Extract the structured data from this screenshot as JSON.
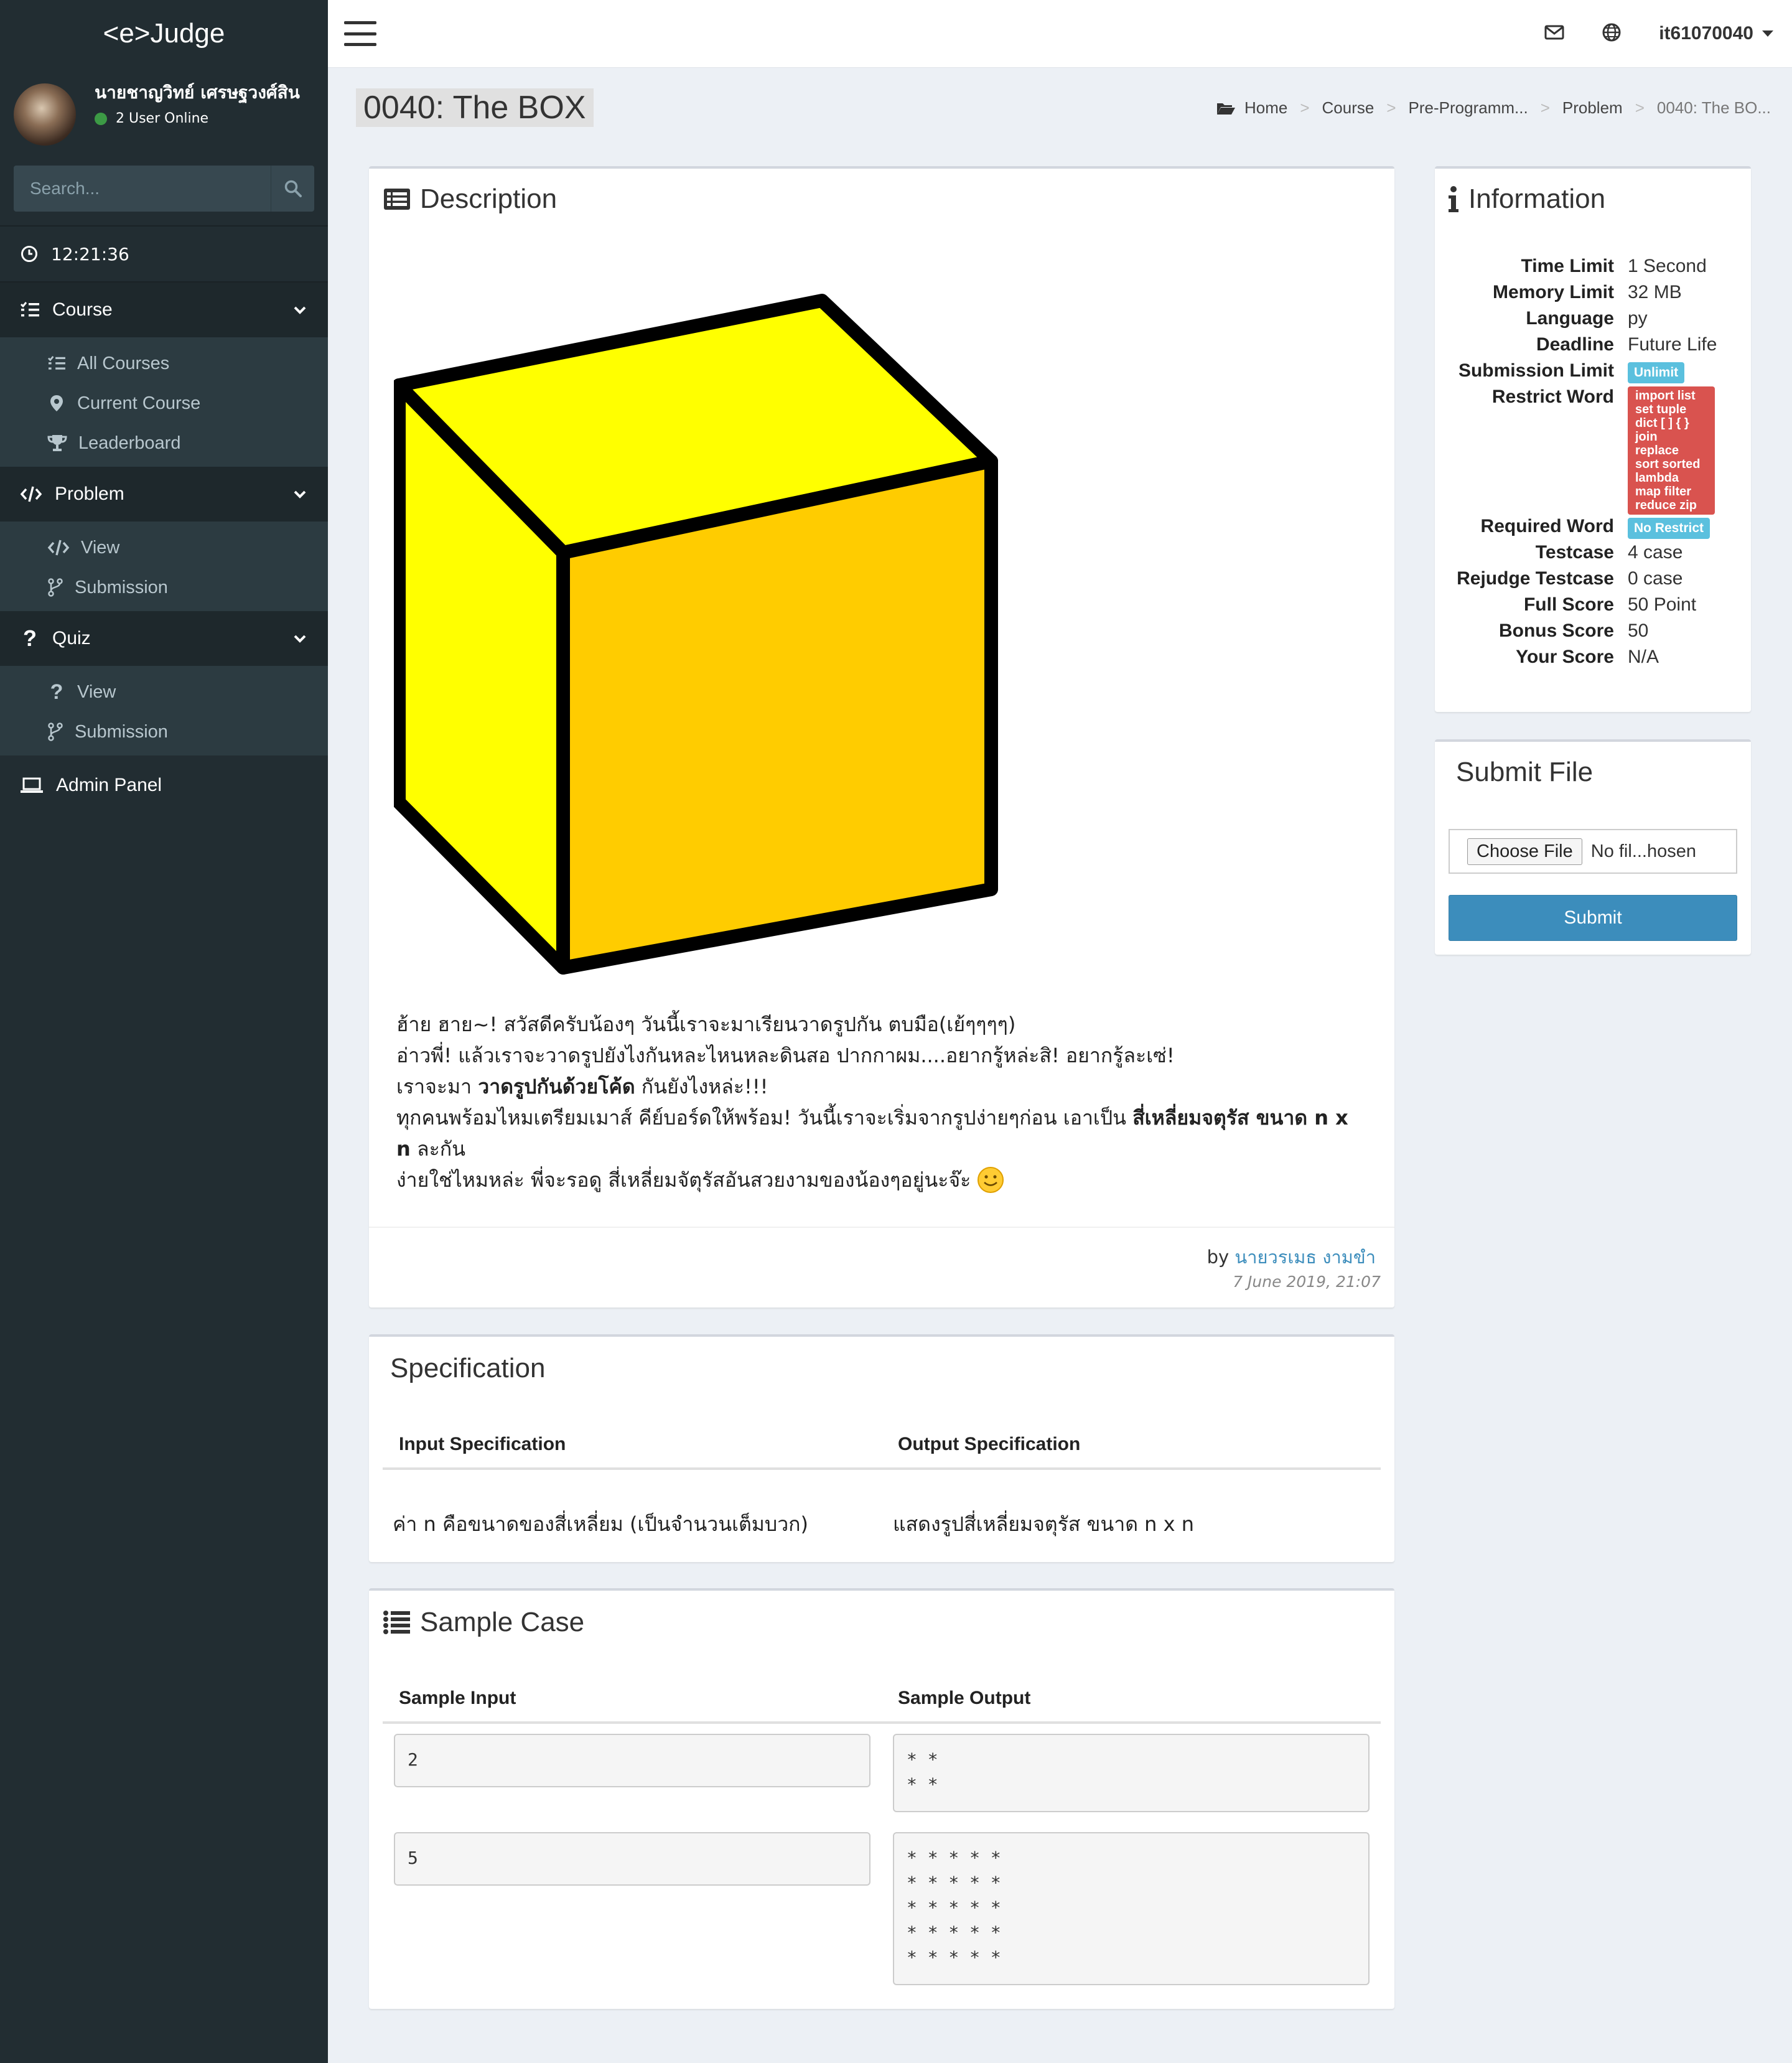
{
  "app": {
    "logo": "<e>Judge"
  },
  "user": {
    "name": "นายชาญวิทย์ เศรษฐวงศ์สิน",
    "online": "2 User Online"
  },
  "search": {
    "placeholder": "Search..."
  },
  "clock": "12:21:36",
  "nav": {
    "course": {
      "label": "Course",
      "items": [
        "All Courses",
        "Current Course",
        "Leaderboard"
      ]
    },
    "problem": {
      "label": "Problem",
      "items": [
        "View",
        "Submission"
      ]
    },
    "quiz": {
      "label": "Quiz",
      "items": [
        "View",
        "Submission"
      ]
    },
    "admin": "Admin Panel"
  },
  "header": {
    "username": "it61070040"
  },
  "page": {
    "title": "0040: The BOX",
    "breadcrumb": [
      "Home",
      "Course",
      "Pre-Programm...",
      "Problem",
      "0040: The BO..."
    ]
  },
  "description": {
    "title": "Description",
    "lines": {
      "l1": "ฮ้าย ฮาย~! สวัสดีครับน้องๆ วันนี้เราจะมาเรียนวาดรูปกัน ตบมือ(เย้ๆๆๆๆ)",
      "l2": "อ่าวพี่! แล้วเราจะวาดรูปยังไงกันหละไหนหละดินสอ ปากกาผม....อยากรู้หล่ะสิ! อยากรู้ละเซ่!",
      "l3a": "เราจะมา ",
      "l3b": "วาดรูปกันด้วยโค้ด",
      "l3c": " กันยังไงหล่ะ!!!",
      "l4a": "ทุกคนพร้อมไหมเตรียมเมาส์ คีย์บอร์ดให้พร้อม! วันนี้เราจะเริ่มจากรูปง่ายๆก่อน เอาเป็น ",
      "l4b": "สี่เหลี่ยมจตุรัส ขนาด n x n",
      "l4c": " ละกัน",
      "l5": "ง่ายใช่ไหมหล่ะ พี่จะรอดู สี่เหลี่ยมจัตุรัสอันสวยงามของน้องๆอยู่นะจ๊ะ"
    },
    "by_label": "by",
    "author": "นายวรเมธ งามขำ",
    "date": "7 June 2019, 21:07",
    "colors": {
      "front": "#ffcc00",
      "side": "#ffff00",
      "top": "#ffff00",
      "edge": "#000000"
    }
  },
  "info": {
    "title": "Information",
    "rows": [
      {
        "key": "Time Limit",
        "value": "1 Second"
      },
      {
        "key": "Memory Limit",
        "value": "32 MB"
      },
      {
        "key": "Language",
        "value": "py"
      },
      {
        "key": "Deadline",
        "value": "Future Life"
      },
      {
        "key": "Submission Limit",
        "badge": "Unlimit"
      },
      {
        "key": "Restrict Word",
        "words": [
          "import list",
          "set tuple",
          "dict [ ] { }",
          "join",
          "replace",
          "sort sorted",
          "lambda",
          "map filter",
          "reduce zip"
        ]
      },
      {
        "key": "Required Word",
        "badge": "No Restrict"
      },
      {
        "key": "Testcase",
        "value": "4 case"
      },
      {
        "key": "Rejudge Testcase",
        "value": "0 case"
      },
      {
        "key": "Full Score",
        "value": "50 Point"
      },
      {
        "key": "Bonus Score",
        "value": "50"
      },
      {
        "key": "Your Score",
        "value": "N/A"
      }
    ]
  },
  "submit": {
    "title": "Submit File",
    "choose": "Choose File",
    "status": "No fil...hosen",
    "button": "Submit"
  },
  "spec": {
    "title": "Specification",
    "input_header": "Input Specification",
    "output_header": "Output Specification",
    "input": "ค่า n คือขนาดของสี่เหลี่ยม (เป็นจำนวนเต็มบวก)",
    "output": "แสดงรูปสี่เหลี่ยมจตุรัส ขนาด n x n"
  },
  "sample": {
    "title": "Sample Case",
    "input_header": "Sample Input",
    "output_header": "Sample Output",
    "cases": [
      {
        "input": "2",
        "output": "* *\n* *"
      },
      {
        "input": "5",
        "output": "* * * * *\n* * * * *\n* * * * *\n* * * * *\n* * * * *"
      }
    ]
  }
}
